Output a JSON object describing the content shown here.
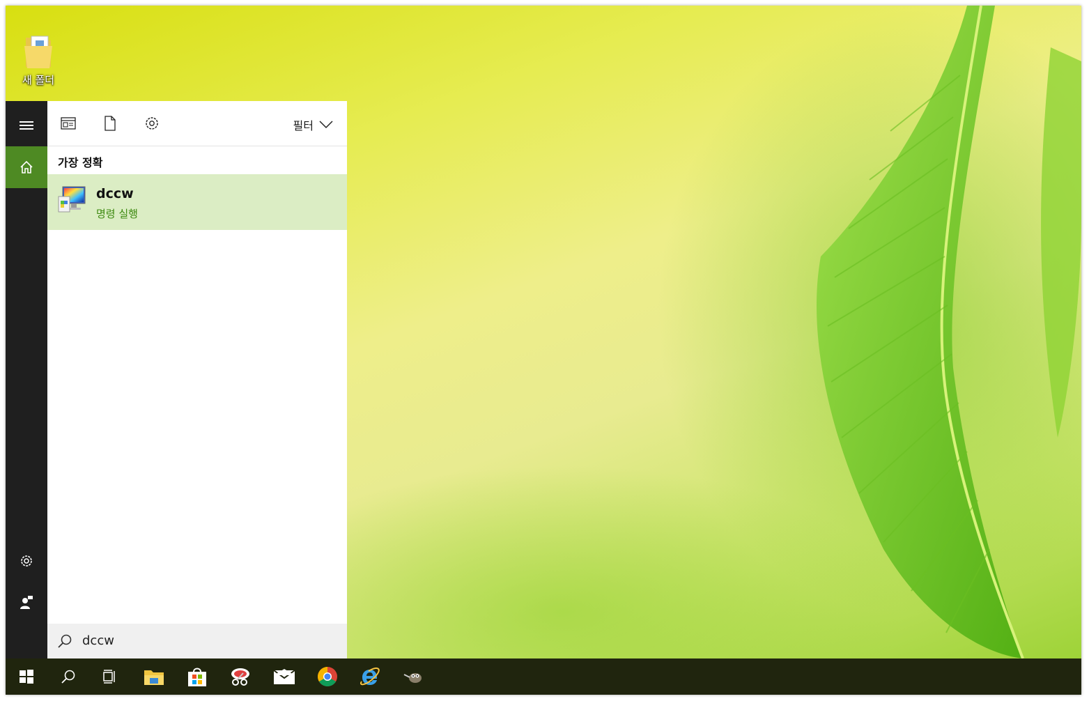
{
  "desktop": {
    "icons": [
      {
        "label": "새 폴더",
        "icon": "folder-icon"
      }
    ]
  },
  "start_panel": {
    "rail": [
      {
        "name": "hamburger-menu-icon",
        "active": false
      },
      {
        "name": "home-icon",
        "active": true
      },
      {
        "name": "settings-icon",
        "active": false
      },
      {
        "name": "user-feedback-icon",
        "active": false
      }
    ],
    "toolbar": {
      "icons": [
        "apps-icon",
        "documents-icon",
        "settings-icon"
      ],
      "filter_label": "필터"
    },
    "section_title": "가장 정확",
    "best_match": {
      "name": "dccw",
      "subtitle": "명령 실행",
      "icon": "display-color-calibration-icon"
    },
    "search": {
      "query": "dccw",
      "icon": "search-icon"
    }
  },
  "taskbar": {
    "items": [
      "windows-start-icon",
      "search-icon",
      "task-view-icon",
      "file-explorer-icon",
      "store-icon",
      "snipping-tool-icon",
      "mail-icon",
      "chrome-icon",
      "internet-explorer-icon",
      "gimp-icon"
    ]
  },
  "colors": {
    "accent": "#4e8a23",
    "selection": "#dbedc4",
    "taskbar": "#20250e",
    "rail": "#1f1f1f",
    "subtitle_green": "#3e8a11"
  }
}
